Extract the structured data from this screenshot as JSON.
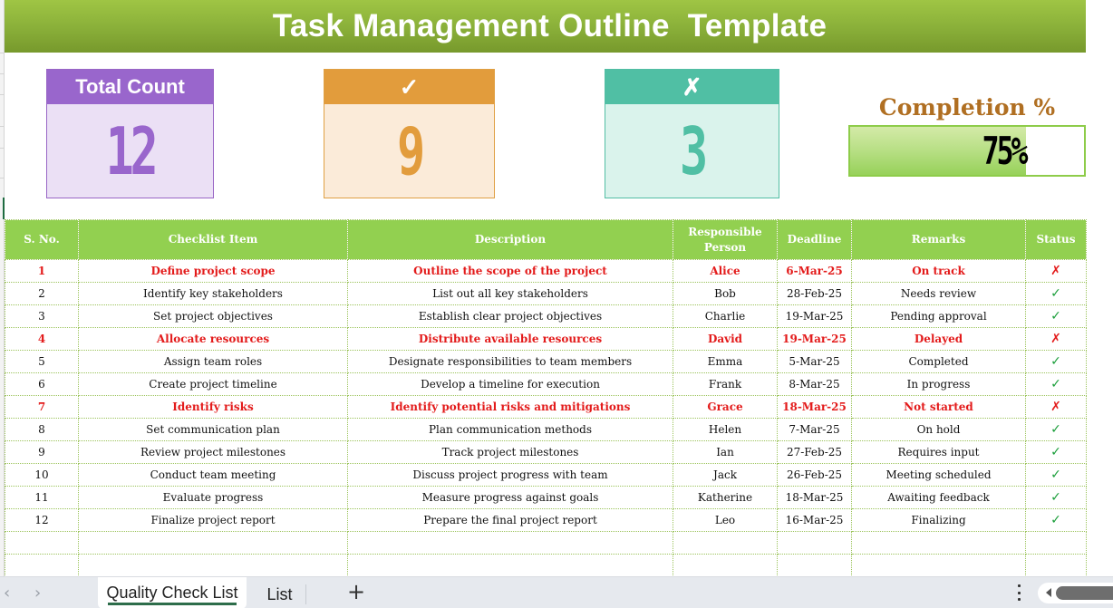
{
  "title": "Task Management Outline  Template",
  "kpis": {
    "total": {
      "label": "Total Count",
      "value": "12"
    },
    "done": {
      "label": "✓",
      "value": "9"
    },
    "failed": {
      "label": "✗",
      "value": "3"
    }
  },
  "completion": {
    "label": "Completion %",
    "value_text": "75%",
    "value": 0.75
  },
  "colors": {
    "banner": "#8bb13a",
    "table_header": "#92d050",
    "total_accent": "#9966cc",
    "done_accent": "#e29c3c",
    "failed_accent": "#50bfa4",
    "late_text": "#e31b1b",
    "check_green": "#1a9e3a"
  },
  "table": {
    "columns": [
      "S. No.",
      "Checklist Item",
      "Description",
      "Responsible Person",
      "Deadline",
      "Remarks",
      "Status"
    ],
    "rows": [
      {
        "no": "1",
        "item": "Define project scope",
        "desc": "Outline the scope of the project",
        "person": "Alice",
        "deadline": "6-Mar-25",
        "remarks": "On track",
        "status": "✗",
        "state": "bad"
      },
      {
        "no": "2",
        "item": "Identify key stakeholders",
        "desc": "List out all key stakeholders",
        "person": "Bob",
        "deadline": "28-Feb-25",
        "remarks": "Needs review",
        "status": "✓",
        "state": "ok"
      },
      {
        "no": "3",
        "item": "Set project objectives",
        "desc": "Establish clear project objectives",
        "person": "Charlie",
        "deadline": "19-Mar-25",
        "remarks": "Pending approval",
        "status": "✓",
        "state": "ok"
      },
      {
        "no": "4",
        "item": "Allocate resources",
        "desc": "Distribute available resources",
        "person": "David",
        "deadline": "19-Mar-25",
        "remarks": "Delayed",
        "status": "✗",
        "state": "bad"
      },
      {
        "no": "5",
        "item": "Assign team roles",
        "desc": "Designate responsibilities to team members",
        "person": "Emma",
        "deadline": "5-Mar-25",
        "remarks": "Completed",
        "status": "✓",
        "state": "ok"
      },
      {
        "no": "6",
        "item": "Create project timeline",
        "desc": "Develop a timeline for execution",
        "person": "Frank",
        "deadline": "8-Mar-25",
        "remarks": "In progress",
        "status": "✓",
        "state": "ok"
      },
      {
        "no": "7",
        "item": "Identify risks",
        "desc": "Identify potential risks and mitigations",
        "person": "Grace",
        "deadline": "18-Mar-25",
        "remarks": "Not started",
        "status": "✗",
        "state": "bad"
      },
      {
        "no": "8",
        "item": "Set communication plan",
        "desc": "Plan communication methods",
        "person": "Helen",
        "deadline": "7-Mar-25",
        "remarks": "On hold",
        "status": "✓",
        "state": "ok"
      },
      {
        "no": "9",
        "item": "Review project milestones",
        "desc": "Track project milestones",
        "person": "Ian",
        "deadline": "27-Feb-25",
        "remarks": "Requires input",
        "status": "✓",
        "state": "ok"
      },
      {
        "no": "10",
        "item": "Conduct team meeting",
        "desc": "Discuss project progress with team",
        "person": "Jack",
        "deadline": "26-Feb-25",
        "remarks": "Meeting scheduled",
        "status": "✓",
        "state": "ok"
      },
      {
        "no": "11",
        "item": "Evaluate progress",
        "desc": "Measure progress against goals",
        "person": "Katherine",
        "deadline": "18-Mar-25",
        "remarks": "Awaiting feedback",
        "status": "✓",
        "state": "ok"
      },
      {
        "no": "12",
        "item": "Finalize project report",
        "desc": "Prepare the final project report",
        "person": "Leo",
        "deadline": "16-Mar-25",
        "remarks": "Finalizing",
        "status": "✓",
        "state": "ok"
      }
    ],
    "blank_rows": 2
  },
  "sheet_tabs": {
    "nav_prev": "‹",
    "nav_next": "›",
    "tabs": [
      "Quality Check List",
      "List"
    ],
    "active": "Quality Check List",
    "add_label": "+"
  }
}
